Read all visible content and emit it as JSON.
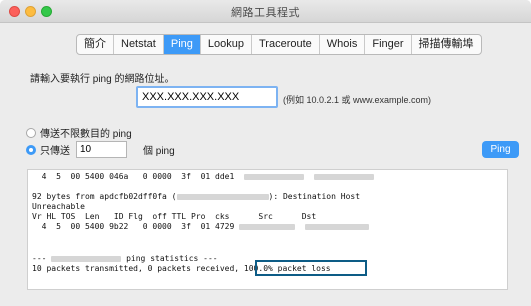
{
  "window": {
    "title": "網路工具程式"
  },
  "tabs": [
    {
      "label": "簡介"
    },
    {
      "label": "Netstat"
    },
    {
      "label": "Ping"
    },
    {
      "label": "Lookup"
    },
    {
      "label": "Traceroute"
    },
    {
      "label": "Whois"
    },
    {
      "label": "Finger"
    },
    {
      "label": "掃描傳輸埠"
    }
  ],
  "ping": {
    "prompt": "請輸入要執行 ping 的網路位址。",
    "address_value": "XXX.XXX.XXX.XXX",
    "hint": "(例如 10.0.2.1 或 www.example.com)",
    "unlimited_label": "傳送不限數目的 ping",
    "only_send_label": "只傳送",
    "count_value": "10",
    "count_suffix": "個 ping",
    "button_label": "Ping"
  },
  "output": {
    "line1a": "  4  5  00 5400 046a   0 0000  3f  01 dde1",
    "line2a": "92 bytes from apdcfb02dff0fa (",
    "line2b": "): Destination Host",
    "line3": "Unreachable",
    "line4": "Vr HL TOS  Len   ID Flg  off TTL Pro  cks      Src      Dst",
    "line5a": "  4  5  00 5400 9b22   0 0000  3f  01 4729",
    "line6a": "---",
    "line6b": "ping statistics ---",
    "line7a": "10 packets transmitted, 0 packets received, ",
    "line7b": "100.0% packet loss"
  }
}
